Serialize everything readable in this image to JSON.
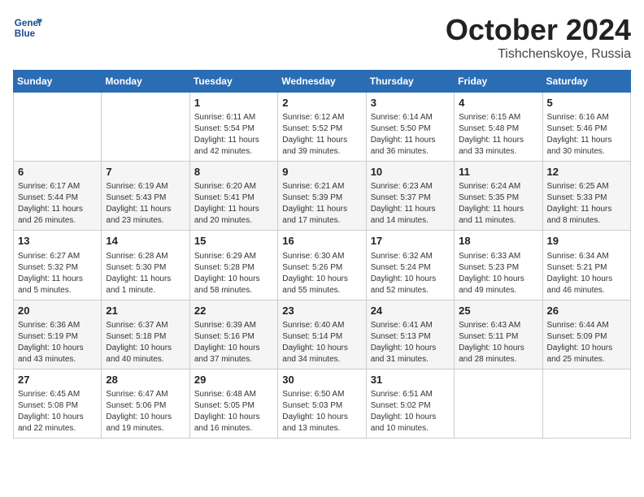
{
  "header": {
    "logo_line1": "General",
    "logo_line2": "Blue",
    "month": "October 2024",
    "location": "Tishchenskoye, Russia"
  },
  "weekdays": [
    "Sunday",
    "Monday",
    "Tuesday",
    "Wednesday",
    "Thursday",
    "Friday",
    "Saturday"
  ],
  "weeks": [
    [
      {
        "day": "",
        "sunrise": "",
        "sunset": "",
        "daylight": ""
      },
      {
        "day": "",
        "sunrise": "",
        "sunset": "",
        "daylight": ""
      },
      {
        "day": "1",
        "sunrise": "Sunrise: 6:11 AM",
        "sunset": "Sunset: 5:54 PM",
        "daylight": "Daylight: 11 hours and 42 minutes."
      },
      {
        "day": "2",
        "sunrise": "Sunrise: 6:12 AM",
        "sunset": "Sunset: 5:52 PM",
        "daylight": "Daylight: 11 hours and 39 minutes."
      },
      {
        "day": "3",
        "sunrise": "Sunrise: 6:14 AM",
        "sunset": "Sunset: 5:50 PM",
        "daylight": "Daylight: 11 hours and 36 minutes."
      },
      {
        "day": "4",
        "sunrise": "Sunrise: 6:15 AM",
        "sunset": "Sunset: 5:48 PM",
        "daylight": "Daylight: 11 hours and 33 minutes."
      },
      {
        "day": "5",
        "sunrise": "Sunrise: 6:16 AM",
        "sunset": "Sunset: 5:46 PM",
        "daylight": "Daylight: 11 hours and 30 minutes."
      }
    ],
    [
      {
        "day": "6",
        "sunrise": "Sunrise: 6:17 AM",
        "sunset": "Sunset: 5:44 PM",
        "daylight": "Daylight: 11 hours and 26 minutes."
      },
      {
        "day": "7",
        "sunrise": "Sunrise: 6:19 AM",
        "sunset": "Sunset: 5:43 PM",
        "daylight": "Daylight: 11 hours and 23 minutes."
      },
      {
        "day": "8",
        "sunrise": "Sunrise: 6:20 AM",
        "sunset": "Sunset: 5:41 PM",
        "daylight": "Daylight: 11 hours and 20 minutes."
      },
      {
        "day": "9",
        "sunrise": "Sunrise: 6:21 AM",
        "sunset": "Sunset: 5:39 PM",
        "daylight": "Daylight: 11 hours and 17 minutes."
      },
      {
        "day": "10",
        "sunrise": "Sunrise: 6:23 AM",
        "sunset": "Sunset: 5:37 PM",
        "daylight": "Daylight: 11 hours and 14 minutes."
      },
      {
        "day": "11",
        "sunrise": "Sunrise: 6:24 AM",
        "sunset": "Sunset: 5:35 PM",
        "daylight": "Daylight: 11 hours and 11 minutes."
      },
      {
        "day": "12",
        "sunrise": "Sunrise: 6:25 AM",
        "sunset": "Sunset: 5:33 PM",
        "daylight": "Daylight: 11 hours and 8 minutes."
      }
    ],
    [
      {
        "day": "13",
        "sunrise": "Sunrise: 6:27 AM",
        "sunset": "Sunset: 5:32 PM",
        "daylight": "Daylight: 11 hours and 5 minutes."
      },
      {
        "day": "14",
        "sunrise": "Sunrise: 6:28 AM",
        "sunset": "Sunset: 5:30 PM",
        "daylight": "Daylight: 11 hours and 1 minute."
      },
      {
        "day": "15",
        "sunrise": "Sunrise: 6:29 AM",
        "sunset": "Sunset: 5:28 PM",
        "daylight": "Daylight: 10 hours and 58 minutes."
      },
      {
        "day": "16",
        "sunrise": "Sunrise: 6:30 AM",
        "sunset": "Sunset: 5:26 PM",
        "daylight": "Daylight: 10 hours and 55 minutes."
      },
      {
        "day": "17",
        "sunrise": "Sunrise: 6:32 AM",
        "sunset": "Sunset: 5:24 PM",
        "daylight": "Daylight: 10 hours and 52 minutes."
      },
      {
        "day": "18",
        "sunrise": "Sunrise: 6:33 AM",
        "sunset": "Sunset: 5:23 PM",
        "daylight": "Daylight: 10 hours and 49 minutes."
      },
      {
        "day": "19",
        "sunrise": "Sunrise: 6:34 AM",
        "sunset": "Sunset: 5:21 PM",
        "daylight": "Daylight: 10 hours and 46 minutes."
      }
    ],
    [
      {
        "day": "20",
        "sunrise": "Sunrise: 6:36 AM",
        "sunset": "Sunset: 5:19 PM",
        "daylight": "Daylight: 10 hours and 43 minutes."
      },
      {
        "day": "21",
        "sunrise": "Sunrise: 6:37 AM",
        "sunset": "Sunset: 5:18 PM",
        "daylight": "Daylight: 10 hours and 40 minutes."
      },
      {
        "day": "22",
        "sunrise": "Sunrise: 6:39 AM",
        "sunset": "Sunset: 5:16 PM",
        "daylight": "Daylight: 10 hours and 37 minutes."
      },
      {
        "day": "23",
        "sunrise": "Sunrise: 6:40 AM",
        "sunset": "Sunset: 5:14 PM",
        "daylight": "Daylight: 10 hours and 34 minutes."
      },
      {
        "day": "24",
        "sunrise": "Sunrise: 6:41 AM",
        "sunset": "Sunset: 5:13 PM",
        "daylight": "Daylight: 10 hours and 31 minutes."
      },
      {
        "day": "25",
        "sunrise": "Sunrise: 6:43 AM",
        "sunset": "Sunset: 5:11 PM",
        "daylight": "Daylight: 10 hours and 28 minutes."
      },
      {
        "day": "26",
        "sunrise": "Sunrise: 6:44 AM",
        "sunset": "Sunset: 5:09 PM",
        "daylight": "Daylight: 10 hours and 25 minutes."
      }
    ],
    [
      {
        "day": "27",
        "sunrise": "Sunrise: 6:45 AM",
        "sunset": "Sunset: 5:08 PM",
        "daylight": "Daylight: 10 hours and 22 minutes."
      },
      {
        "day": "28",
        "sunrise": "Sunrise: 6:47 AM",
        "sunset": "Sunset: 5:06 PM",
        "daylight": "Daylight: 10 hours and 19 minutes."
      },
      {
        "day": "29",
        "sunrise": "Sunrise: 6:48 AM",
        "sunset": "Sunset: 5:05 PM",
        "daylight": "Daylight: 10 hours and 16 minutes."
      },
      {
        "day": "30",
        "sunrise": "Sunrise: 6:50 AM",
        "sunset": "Sunset: 5:03 PM",
        "daylight": "Daylight: 10 hours and 13 minutes."
      },
      {
        "day": "31",
        "sunrise": "Sunrise: 6:51 AM",
        "sunset": "Sunset: 5:02 PM",
        "daylight": "Daylight: 10 hours and 10 minutes."
      },
      {
        "day": "",
        "sunrise": "",
        "sunset": "",
        "daylight": ""
      },
      {
        "day": "",
        "sunrise": "",
        "sunset": "",
        "daylight": ""
      }
    ]
  ]
}
